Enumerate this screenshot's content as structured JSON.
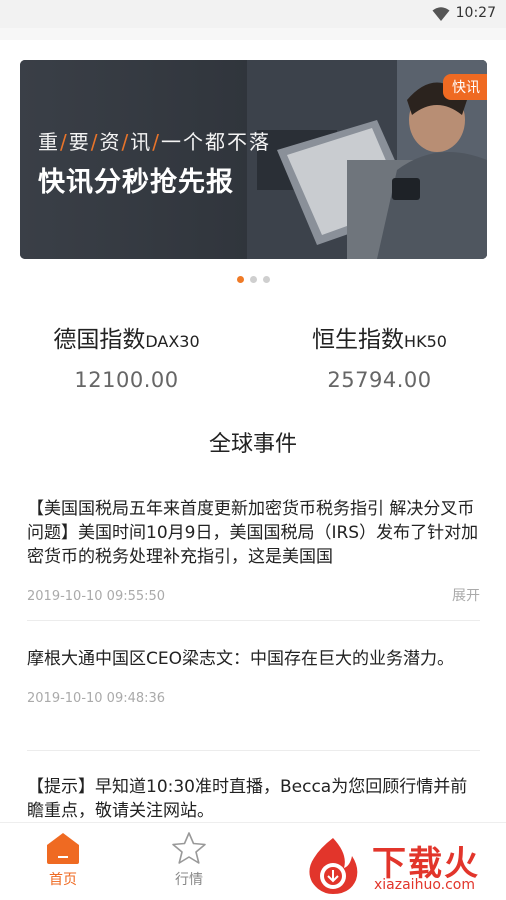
{
  "status_bar": {
    "time": "10:27",
    "icons": [
      "wifi-icon"
    ]
  },
  "banner": {
    "tag": "快讯",
    "headline_parts": [
      "重",
      "要",
      "资",
      "讯",
      "一个都不落"
    ],
    "slogan": "快讯分秒抢先报",
    "accent_color": "#ef6a22",
    "carousel": {
      "count": 3,
      "active": 0
    }
  },
  "indices": [
    {
      "name": "德国指数",
      "code": "DAX30",
      "value": "12100.00"
    },
    {
      "name": "恒生指数",
      "code": "HK50",
      "value": "25794.00"
    }
  ],
  "section_title": "全球事件",
  "news": [
    {
      "text": "【美国国税局五年来首度更新加密货币税务指引 解决分叉币问题】美国时间10月9日，美国国税局（IRS）发布了针对加密货币的税务处理补充指引，这是美国国",
      "time": "2019-10-10 09:55:50",
      "expand": "展开"
    },
    {
      "text": "摩根大通中国区CEO梁志文：中国存在巨大的业务潜力。",
      "time": "2019-10-10 09:48:36"
    },
    {
      "text": "【提示】早知道10:30准时直播，Becca为您回顾行情并前瞻重点，敬请关注网站。"
    }
  ],
  "tabbar": {
    "items": [
      {
        "label": "首页",
        "icon": "home-icon",
        "active": true
      },
      {
        "label": "行情",
        "icon": "star-icon",
        "active": false
      }
    ]
  },
  "watermark": {
    "title": "下载火",
    "url": "xiazaihuo.com"
  }
}
